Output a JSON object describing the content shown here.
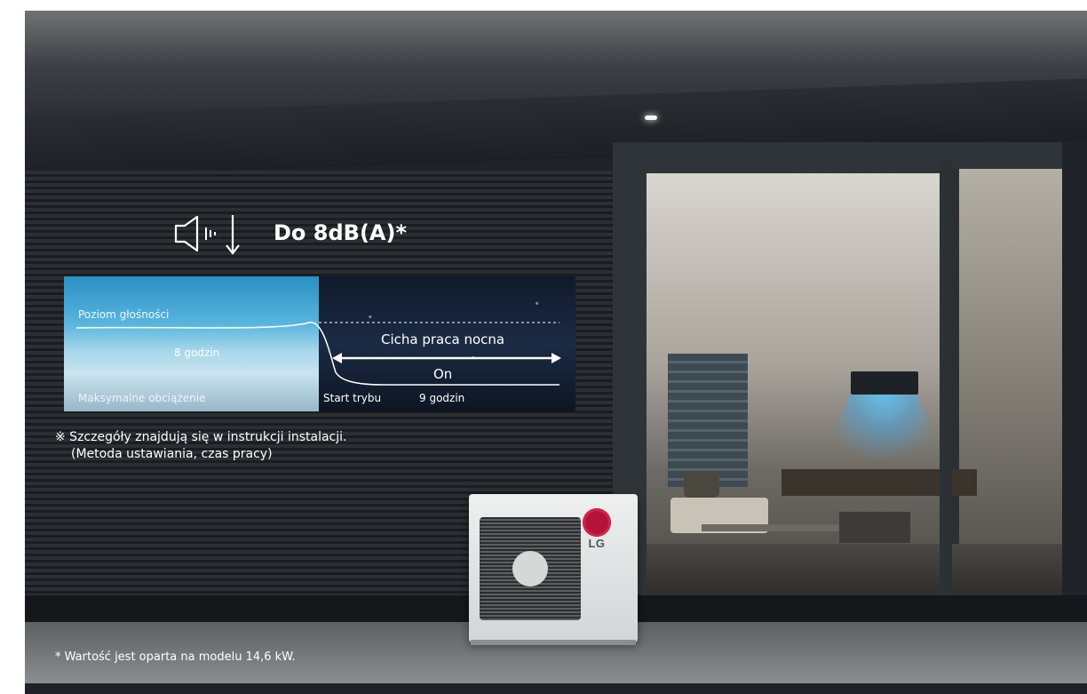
{
  "headline": "Do 8dB(A)*",
  "graph": {
    "noise_level_label": "Poziom głośności",
    "day_duration": "8 godzin",
    "max_load_label": "Maksymalne obciążenie",
    "night_mode_title": "Cicha praca nocna",
    "night_mode_state": "On",
    "mode_start_label": "Start trybu",
    "night_duration": "9 godzin"
  },
  "install_note_line1": "※ Szczegóły znajdują się w instrukcji instalacji.",
  "install_note_line2": "(Metoda ustawiania, czas pracy)",
  "footnote": "* Wartość jest oparta na modelu 14,6 kW.",
  "brand": "LG",
  "icons": {
    "speaker": "speaker-volume-down-icon"
  },
  "colors": {
    "text": "#ffffff",
    "lg_red": "#b5133a"
  }
}
